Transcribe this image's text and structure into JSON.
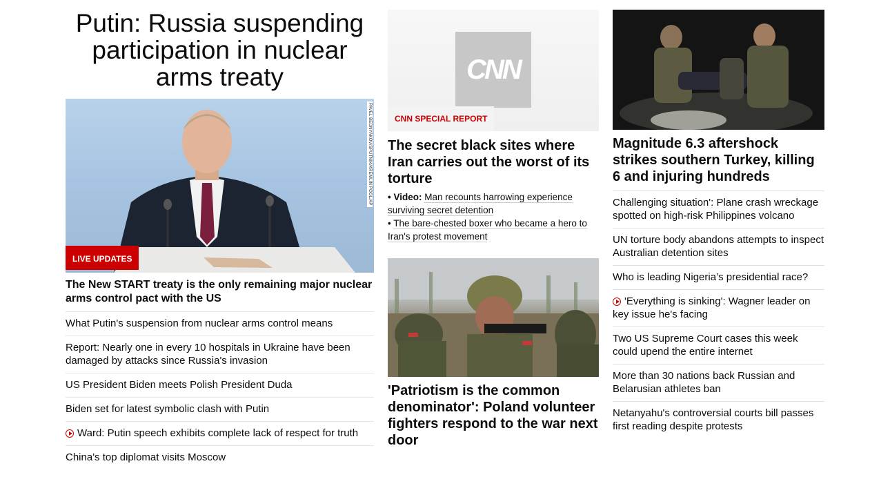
{
  "column1": {
    "headline": "Putin: Russia suspending participation in nuclear arms treaty",
    "photo_credit": "PAVEL BEDNYAKOV/SPUTNIK/KREMLIN POOL/AP",
    "badge": "LIVE UPDATES",
    "lead_sub": "The New START treaty is the only remaining major nuclear arms control pact with the US",
    "items": [
      {
        "label": "What Putin's suspension from nuclear arms control means",
        "video": false
      },
      {
        "label": "Report: Nearly one in every 10 hospitals in Ukraine have been damaged by attacks since Russia's invasion",
        "video": false
      },
      {
        "label": "US President Biden meets Polish President Duda",
        "video": false
      },
      {
        "label": "Biden set for latest symbolic clash with Putin",
        "video": false
      },
      {
        "label": "Ward: Putin speech exhibits complete lack of respect for truth",
        "video": true
      },
      {
        "label": "China's top diplomat visits Moscow",
        "video": false
      }
    ]
  },
  "column2": {
    "logo_text": "CNN",
    "badge": "CNN SPECIAL REPORT",
    "story_title": "The secret black sites where Iran carries out the worst of its torture",
    "sublinks": [
      {
        "prefix": "• Video:",
        "text": "Man recounts harrowing experience surviving secret detention"
      },
      {
        "prefix": "•",
        "text": "The bare-chested boxer who became a hero to Iran's protest movement"
      }
    ],
    "poland_title": "'Patriotism is the common denominator': Poland volunteer fighters respond to the war next door"
  },
  "column3": {
    "lead_title": "Magnitude 6.3 aftershock strikes southern Turkey, killing 6 and injuring hundreds",
    "items": [
      {
        "label": "Challenging situation': Plane crash wreckage spotted on high-risk Philippines volcano",
        "video": false
      },
      {
        "label": "UN torture body abandons attempts to inspect Australian detention sites",
        "video": false
      },
      {
        "label": "Who is leading Nigeria’s presidential race?",
        "video": false
      },
      {
        "label": "'Everything is sinking': Wagner leader on key issue he's facing",
        "video": true
      },
      {
        "label": "Two US Supreme Court cases this week could upend the entire internet",
        "video": false
      },
      {
        "label": "More than 30 nations back Russian and Belarusian athletes ban",
        "video": false
      },
      {
        "label": "Netanyahu's controversial courts bill passes first reading despite protests",
        "video": false
      }
    ]
  },
  "colors": {
    "accent": "#cc0000",
    "text": "#0c0c0c",
    "divider": "#e6e6e6"
  }
}
